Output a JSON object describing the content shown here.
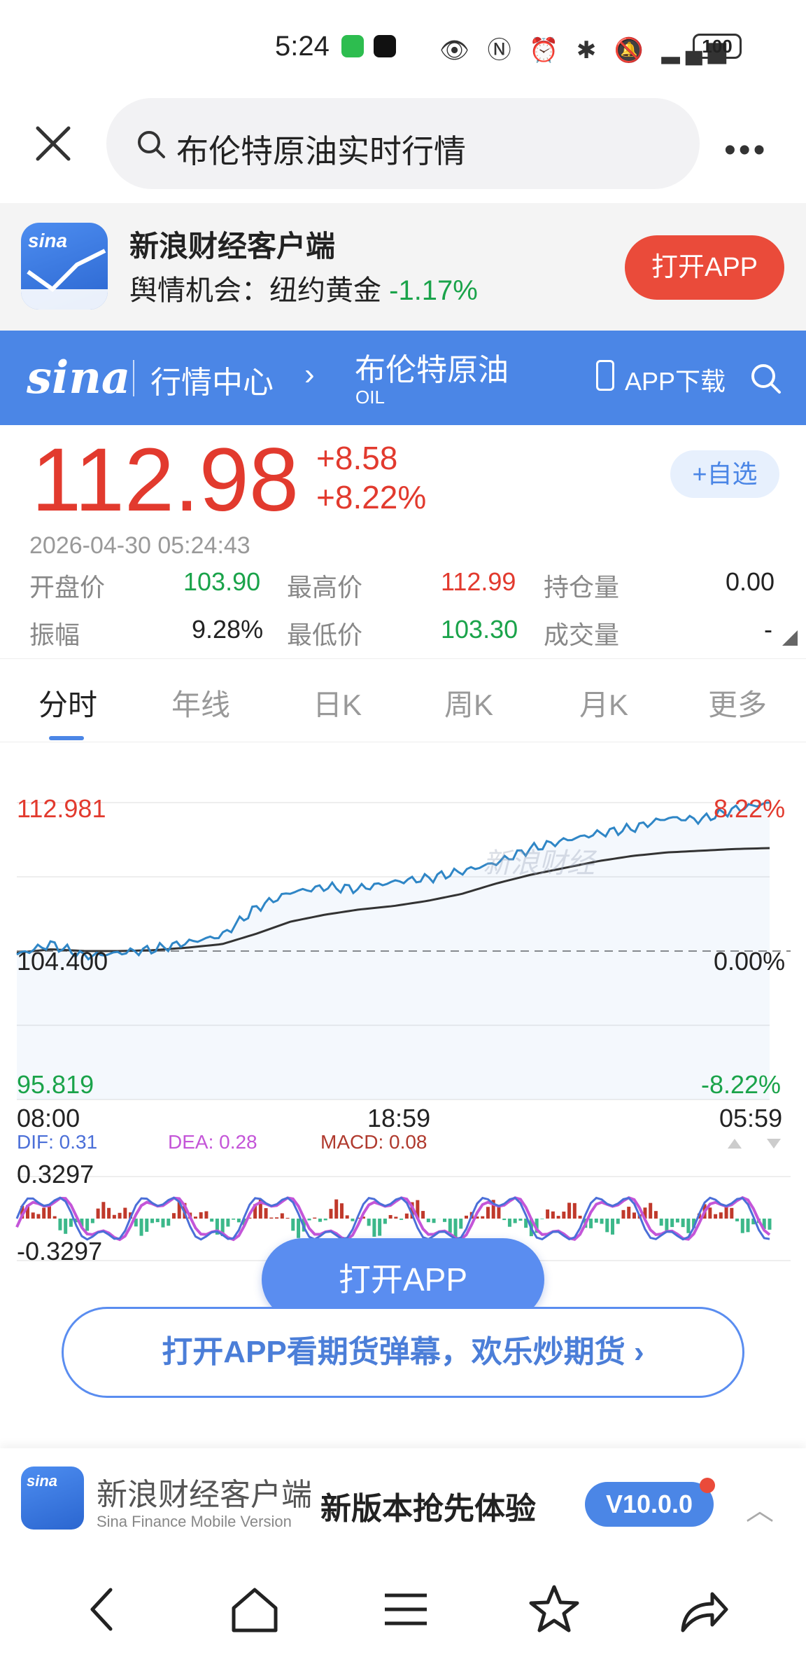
{
  "status_bar": {
    "time": "5:24",
    "icons": [
      "wechat-icon",
      "tiktok-icon",
      "eye-icon",
      "nfc-icon",
      "alarm-icon",
      "bluetooth-icon",
      "mute-icon",
      "signal-icon"
    ],
    "battery": "100"
  },
  "browser": {
    "search_text": "布伦特原油实时行情",
    "more": "•••"
  },
  "promo": {
    "title": "新浪财经客户端",
    "sub_prefix": "舆情机会：纽约黄金",
    "sub_pct": "-1.17%",
    "button": "打开APP",
    "logo_text": "sina"
  },
  "header": {
    "logo": "sina",
    "market": "行情中心",
    "chevron": "›",
    "name": "布伦特原油",
    "code": "OIL",
    "app_download": "APP下载"
  },
  "quote": {
    "price": "112.98",
    "change": "+8.58",
    "change_pct": "+8.22%",
    "watch_button": "+自选",
    "timestamp": "2026-04-30   05:24:43",
    "stats": [
      [
        {
          "label": "开盘价",
          "value": "103.90",
          "color": "green"
        },
        {
          "label": "最高价",
          "value": "112.99",
          "color": "red"
        },
        {
          "label": "持仓量",
          "value": "0.00",
          "color": "dark"
        }
      ],
      [
        {
          "label": "振幅",
          "value": "9.28%",
          "color": "dark"
        },
        {
          "label": "最低价",
          "value": "103.30",
          "color": "green"
        },
        {
          "label": "成交量",
          "value": "-",
          "color": "dark"
        }
      ]
    ]
  },
  "tabs": [
    "分时",
    "年线",
    "日K",
    "周K",
    "月K",
    "更多"
  ],
  "chart": {
    "watermark": "新浪财经",
    "max_price": "112.981",
    "base_price": "104.400",
    "min_price": "95.819",
    "max_pct": "8.22%",
    "base_pct": "0.00%",
    "min_pct": "-8.22%",
    "time_start": "08:00",
    "time_mid": "18:59",
    "time_end": "05:59",
    "dif": "DIF: 0.31",
    "dea": "DEA: 0.28",
    "macd": "MACD: 0.08",
    "macd_max": "0.3297",
    "macd_min": "-0.3297"
  },
  "chart_data": {
    "type": "line",
    "series": [
      {
        "x": [
          "08:00",
          "09:00",
          "10:00",
          "11:00",
          "12:00",
          "13:00",
          "14:00",
          "15:00",
          "16:00",
          "17:00",
          "18:00",
          "18:59",
          "20:00",
          "21:00",
          "22:00",
          "23:00",
          "00:00",
          "01:00",
          "02:00",
          "03:00",
          "04:00",
          "05:00",
          "05:24"
        ],
        "values": [
          104.2,
          104.8,
          104.1,
          104.3,
          104.5,
          104.9,
          105.3,
          106.9,
          107.8,
          108.1,
          108.0,
          108.4,
          108.6,
          109.0,
          109.5,
          110.3,
          110.8,
          111.2,
          111.5,
          112.1,
          112.0,
          112.6,
          112.98
        ]
      },
      {
        "x": [
          "08:00",
          "09:00",
          "10:00",
          "11:00",
          "12:00",
          "13:00",
          "14:00",
          "15:00",
          "16:00",
          "17:00",
          "18:00",
          "18:59",
          "20:00",
          "21:00",
          "22:00",
          "23:00",
          "00:00",
          "01:00",
          "02:00",
          "03:00",
          "04:00",
          "05:00",
          "05:24"
        ],
        "values": [
          104.3,
          104.5,
          104.4,
          104.4,
          104.45,
          104.6,
          104.8,
          105.4,
          106.1,
          106.5,
          106.8,
          107.0,
          107.3,
          107.7,
          108.3,
          108.8,
          109.2,
          109.6,
          109.9,
          110.1,
          110.2,
          110.3,
          110.35
        ]
      }
    ],
    "ylim": [
      95.819,
      112.981
    ],
    "base": 104.4,
    "macd_ylim": [
      -0.3297,
      0.3297
    ]
  },
  "actions": {
    "open_app": "打开APP",
    "danmu": "打开APP看期货弹幕，欢乐炒期货 ›"
  },
  "banner": {
    "name": "新浪财经客户端",
    "sub": "Sina Finance Mobile Version",
    "slogan": "新版本抢先体验",
    "version": "V10.0.0",
    "logo_text": "sina"
  },
  "colors": {
    "accent": "#4b86e6",
    "up": "#e23a2e",
    "down": "#1aa34a",
    "price_line": "#2f86c6",
    "avg_line": "#333333"
  }
}
